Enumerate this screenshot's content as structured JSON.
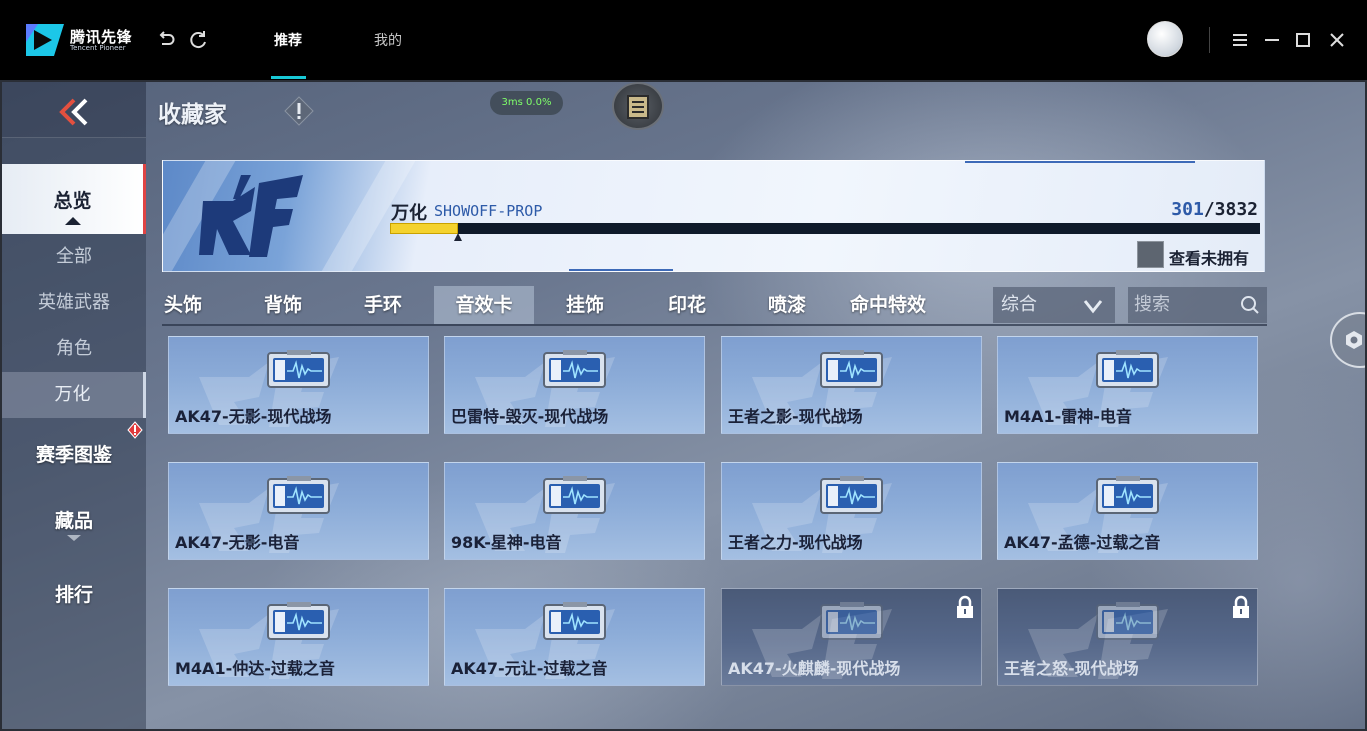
{
  "window": {
    "brand_cn": "腾讯先锋",
    "brand_en": "Tencent Pioneer",
    "tabs": [
      {
        "label": "推荐",
        "active": true
      },
      {
        "label": "我的",
        "active": false
      }
    ],
    "accent_color": "#18c9d6"
  },
  "game": {
    "page_title": "收藏家",
    "ping": "3ms  0.0%",
    "sidebar": {
      "overview": "总览",
      "items": [
        "全部",
        "英雄武器",
        "角色",
        "万化"
      ],
      "active_item": "万化",
      "season": "赛季图鉴",
      "collectibles": "藏品",
      "ranking": "排行"
    },
    "banner": {
      "title": "万化",
      "subtitle": "SHOWOFF-PROP",
      "progress_current": "301",
      "progress_total": "/3832",
      "progress_fraction": 0.0785,
      "owned_label": "查看未拥有"
    },
    "categories": [
      "头饰",
      "背饰",
      "手环",
      "音效卡",
      "挂饰",
      "印花",
      "喷漆",
      "命中特效"
    ],
    "active_category": "音效卡",
    "sort_label": "综合",
    "search_placeholder": "搜索",
    "items": [
      {
        "name": "AK47-无影-现代战场",
        "locked": false
      },
      {
        "name": "巴雷特-毁灭-现代战场",
        "locked": false
      },
      {
        "name": "王者之影-现代战场",
        "locked": false
      },
      {
        "name": "M4A1-雷神-电音",
        "locked": false
      },
      {
        "name": "AK47-无影-电音",
        "locked": false
      },
      {
        "name": "98K-星神-电音",
        "locked": false
      },
      {
        "name": "王者之力-现代战场",
        "locked": false
      },
      {
        "name": "AK47-孟德-过载之音",
        "locked": false
      },
      {
        "name": "M4A1-仲达-过载之音",
        "locked": false
      },
      {
        "name": "AK47-元让-过载之音",
        "locked": false
      },
      {
        "name": "AK47-火麒麟-现代战场",
        "locked": true
      },
      {
        "name": "王者之怒-现代战场",
        "locked": true
      }
    ]
  }
}
